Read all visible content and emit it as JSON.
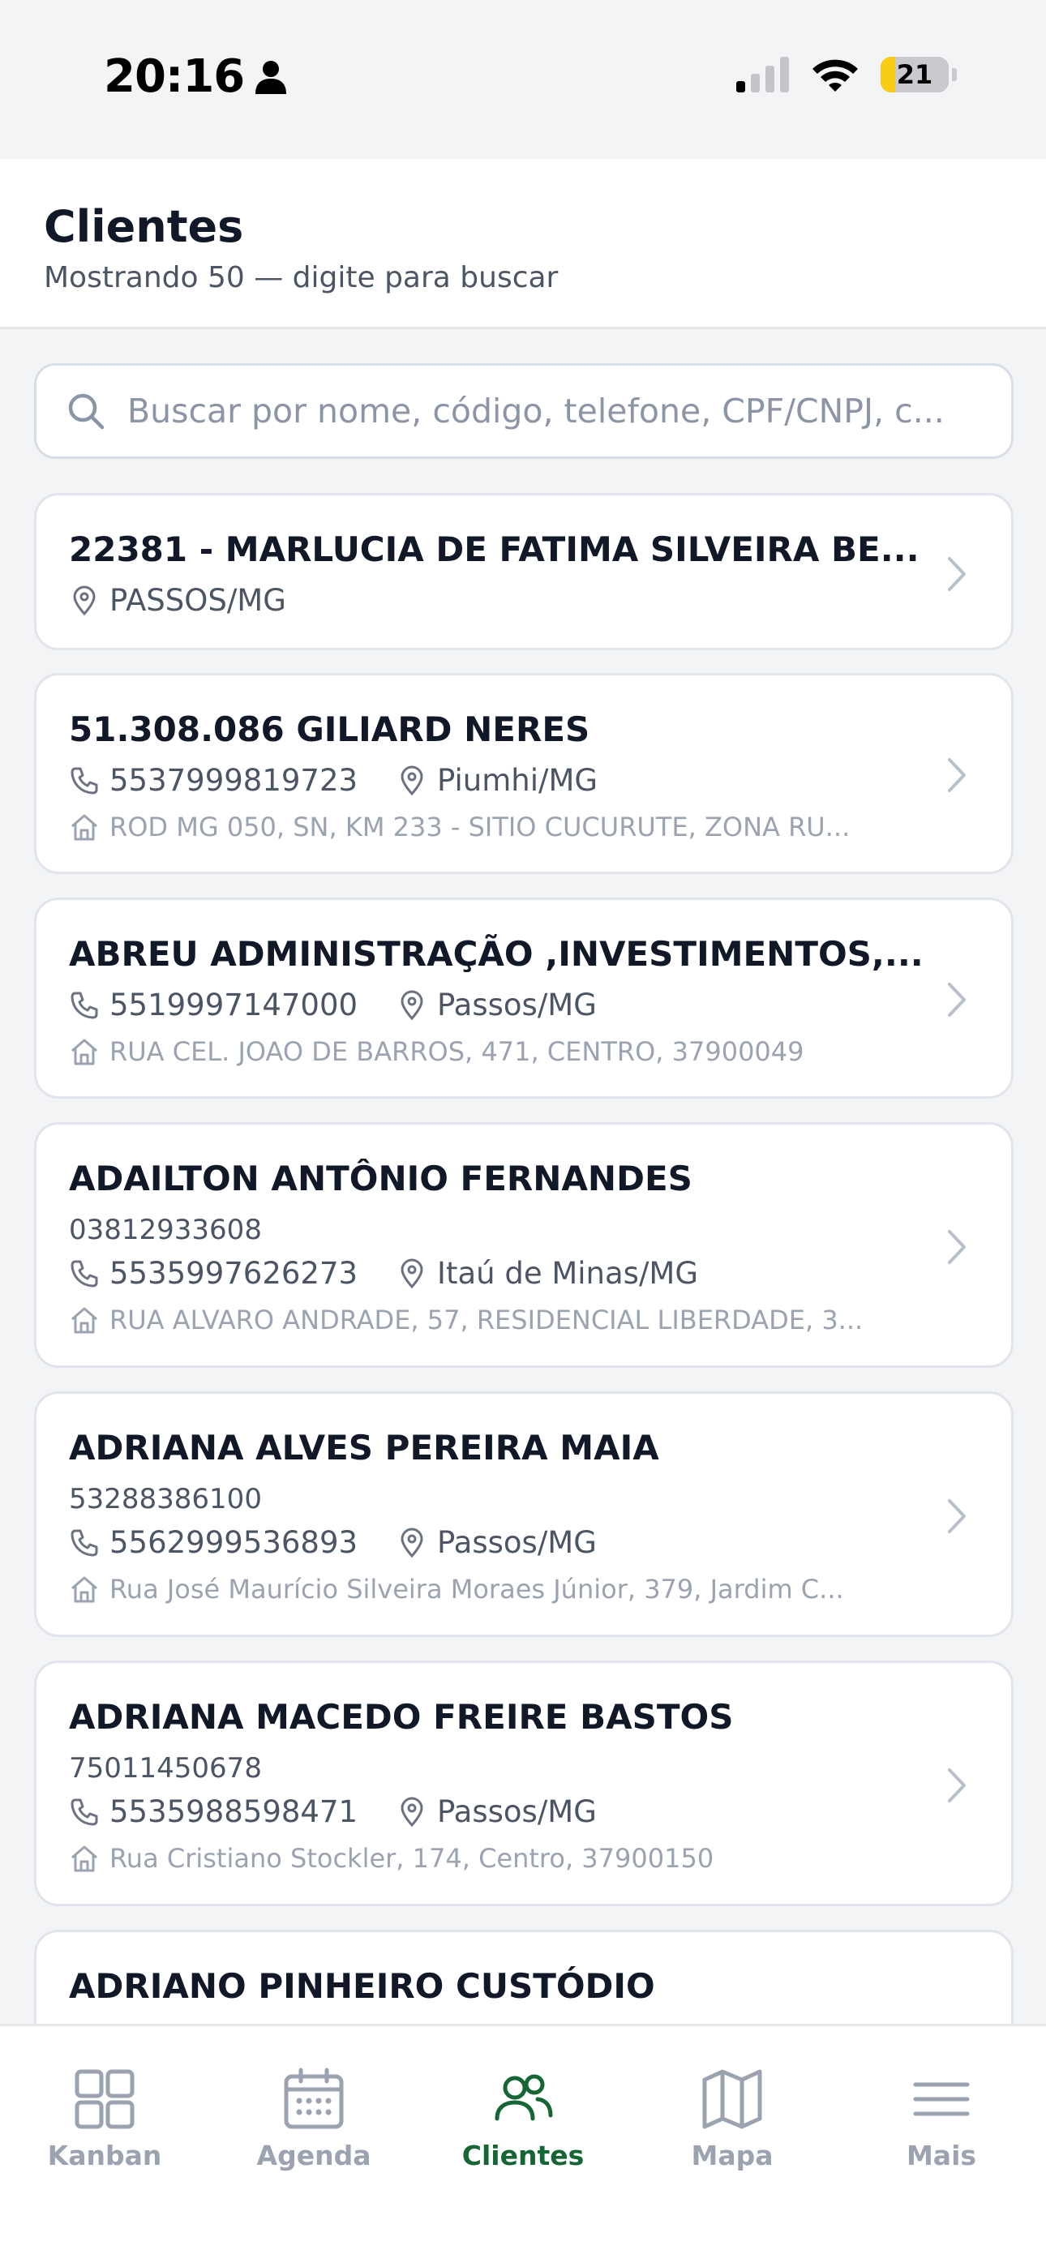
{
  "status_bar": {
    "time": "20:16",
    "battery": "21",
    "battery_level": 0.21
  },
  "header": {
    "title": "Clientes",
    "subtitle": "Mostrando 50 — digite para buscar"
  },
  "search": {
    "placeholder": "Buscar por nome, código, telefone, CPF/CNPJ, c...",
    "value": ""
  },
  "clients": [
    {
      "name": "22381 - MARLUCIA DE FATIMA SILVEIRA BE...",
      "city": "PASSOS/MG"
    },
    {
      "name": "51.308.086 GILIARD NERES",
      "phone": "5537999819723",
      "city": "Piumhi/MG",
      "address": "ROD MG 050, SN, KM 233 - SITIO CUCURUTE, ZONA RU..."
    },
    {
      "name": "ABREU ADMINISTRAÇÃO ,INVESTIMENTOS,...",
      "phone": "5519997147000",
      "city": "Passos/MG",
      "address": "RUA CEL. JOAO DE BARROS, 471, CENTRO, 37900049"
    },
    {
      "name": "ADAILTON ANTÔNIO FERNANDES",
      "doc": "03812933608",
      "phone": "5535997626273",
      "city": "Itaú de Minas/MG",
      "address": "RUA ALVARO ANDRADE, 57, RESIDENCIAL LIBERDADE, 3..."
    },
    {
      "name": "ADRIANA ALVES PEREIRA MAIA",
      "doc": "53288386100",
      "phone": "5562999536893",
      "city": "Passos/MG",
      "address": "Rua José Maurício Silveira Moraes Júnior, 379, Jardim C..."
    },
    {
      "name": "ADRIANA MACEDO FREIRE BASTOS",
      "doc": "75011450678",
      "phone": "5535988598471",
      "city": "Passos/MG",
      "address": "Rua Cristiano Stockler, 174, Centro, 37900150"
    },
    {
      "name": "ADRIANO PINHEIRO CUSTÓDIO"
    }
  ],
  "nav": {
    "items": [
      {
        "label": "Kanban",
        "icon": "grid-icon"
      },
      {
        "label": "Agenda",
        "icon": "calendar-icon"
      },
      {
        "label": "Clientes",
        "icon": "users-icon"
      },
      {
        "label": "Mapa",
        "icon": "map-icon"
      },
      {
        "label": "Mais",
        "icon": "menu-icon"
      }
    ],
    "active": "Clientes"
  },
  "colors": {
    "accent": "#166534",
    "muted": "#9aa3af",
    "battery": "#f9cd15"
  }
}
